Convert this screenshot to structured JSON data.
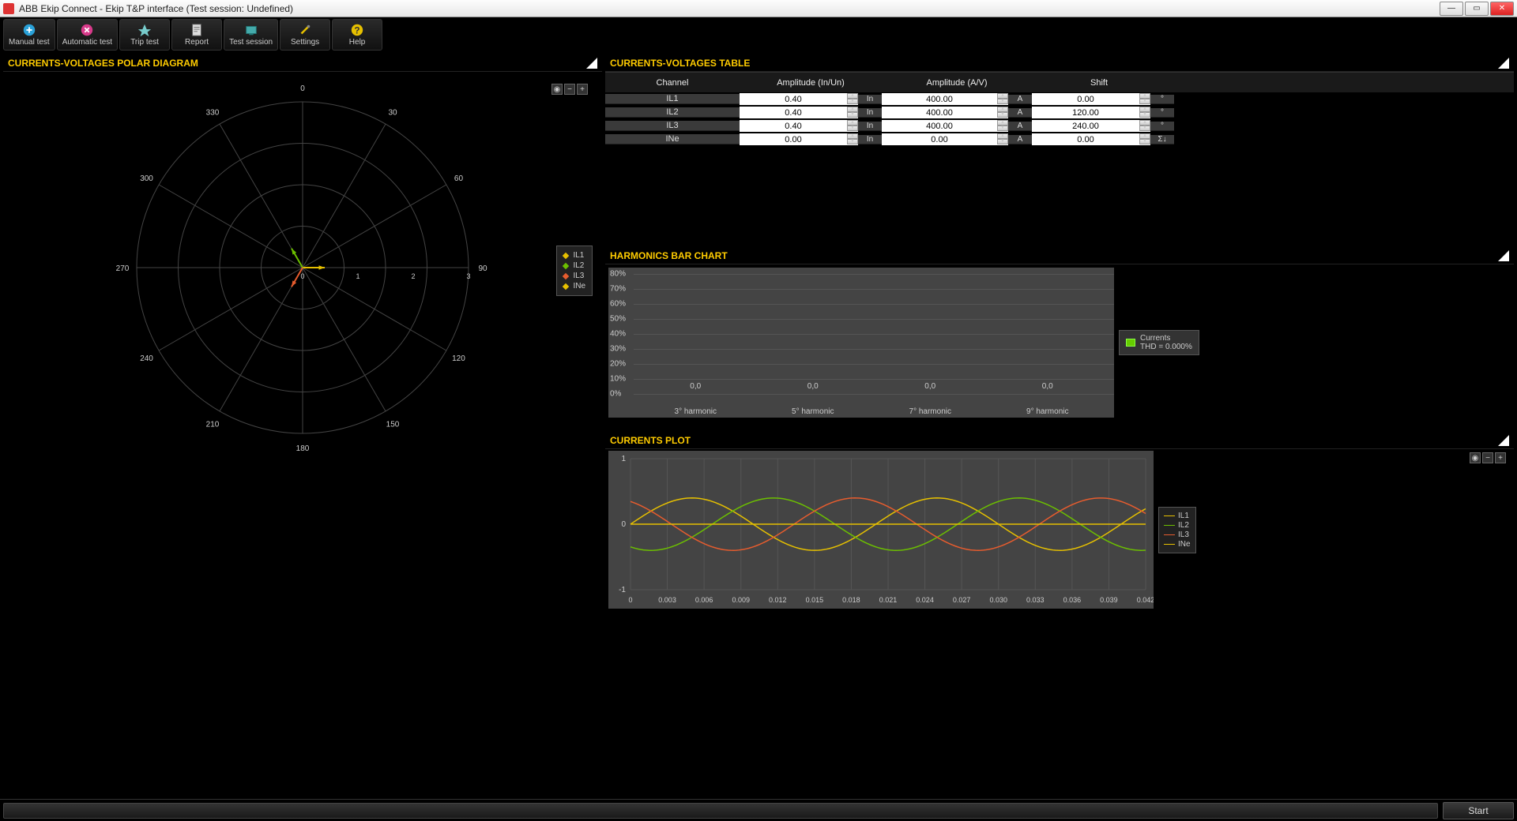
{
  "window": {
    "title": "ABB Ekip Connect - Ekip T&P interface (Test session: Undefined)"
  },
  "toolbar": {
    "manual_test": "Manual test",
    "automatic_test": "Automatic test",
    "trip_test": "Trip test",
    "report": "Report",
    "test_session": "Test session",
    "settings": "Settings",
    "help": "Help"
  },
  "panels": {
    "cv_table": "CURRENTS-VOLTAGES TABLE",
    "harmonics": "HARMONICS BAR CHART",
    "currents_plot": "CURRENTS PLOT",
    "polar": "CURRENTS-VOLTAGES POLAR DIAGRAM"
  },
  "table": {
    "headers": {
      "channel": "Channel",
      "amp_inun": "Amplitude (In/Un)",
      "amp_av": "Amplitude (A/V)",
      "shift": "Shift"
    },
    "rows": [
      {
        "ch": "IL1",
        "amp1": "0.40",
        "u1": "In",
        "amp2": "400.00",
        "u2": "A",
        "shift": "0.00",
        "u3": "°"
      },
      {
        "ch": "IL2",
        "amp1": "0.40",
        "u1": "In",
        "amp2": "400.00",
        "u2": "A",
        "shift": "120.00",
        "u3": "°"
      },
      {
        "ch": "IL3",
        "amp1": "0.40",
        "u1": "In",
        "amp2": "400.00",
        "u2": "A",
        "shift": "240.00",
        "u3": "°"
      },
      {
        "ch": "INe",
        "amp1": "0.00",
        "u1": "In",
        "amp2": "0.00",
        "u2": "A",
        "shift": "0.00",
        "u3": "°"
      }
    ],
    "sigma": "Σ↓"
  },
  "harmonics_legend": {
    "name": "Currents",
    "thd": "THD =  0.000%"
  },
  "polar_legend": [
    {
      "name": "IL1",
      "color": "#e6c000"
    },
    {
      "name": "IL2",
      "color": "#6cbf00"
    },
    {
      "name": "IL3",
      "color": "#e65c2e"
    },
    {
      "name": "INe",
      "color": "#e6c000"
    }
  ],
  "cplot_legend": [
    {
      "name": "IL1",
      "color": "#e6c000"
    },
    {
      "name": "IL2",
      "color": "#6cbf00"
    },
    {
      "name": "IL3",
      "color": "#e65c2e"
    },
    {
      "name": "INe",
      "color": "#e6c000"
    }
  ],
  "footer": {
    "start": "Start"
  },
  "chart_data": [
    {
      "type": "bar",
      "title": "HARMONICS BAR CHART",
      "categories": [
        "3° harmonic",
        "5° harmonic",
        "7° harmonic",
        "9° harmonic"
      ],
      "values": [
        0.0,
        0.0,
        0.0,
        0.0
      ],
      "ylabel": "%",
      "ylim": [
        0,
        80
      ],
      "yticks": [
        0,
        10,
        20,
        30,
        40,
        50,
        60,
        70,
        80
      ],
      "legend": "Currents THD = 0.000%"
    },
    {
      "type": "line",
      "title": "CURRENTS PLOT",
      "x_range": [
        0,
        0.042
      ],
      "xticks": [
        0,
        0.003,
        0.006,
        0.009,
        0.012,
        0.015,
        0.018,
        0.021,
        0.024,
        0.027,
        0.03,
        0.033,
        0.036,
        0.039,
        0.042
      ],
      "ylim": [
        -1,
        1
      ],
      "yticks": [
        -1,
        0,
        1
      ],
      "series": [
        {
          "name": "IL1",
          "amplitude": 0.4,
          "phase_deg": 0,
          "freq_hz": 50,
          "color": "#e6c000"
        },
        {
          "name": "IL2",
          "amplitude": 0.4,
          "phase_deg": 120,
          "freq_hz": 50,
          "color": "#6cbf00"
        },
        {
          "name": "IL3",
          "amplitude": 0.4,
          "phase_deg": 240,
          "freq_hz": 50,
          "color": "#e65c2e"
        },
        {
          "name": "INe",
          "amplitude": 0.0,
          "phase_deg": 0,
          "freq_hz": 50,
          "color": "#e6c000"
        }
      ]
    },
    {
      "type": "polar",
      "title": "CURRENTS-VOLTAGES POLAR DIAGRAM",
      "angle_ticks": [
        0,
        30,
        60,
        90,
        120,
        150,
        180,
        210,
        240,
        270,
        300,
        330
      ],
      "radial_ticks": [
        0,
        1,
        2,
        3
      ],
      "radial_max": 3,
      "vectors": [
        {
          "name": "IL1",
          "magnitude": 0.4,
          "angle_deg": 0,
          "color": "#e6c000"
        },
        {
          "name": "IL2",
          "magnitude": 0.4,
          "angle_deg": 120,
          "color": "#6cbf00"
        },
        {
          "name": "IL3",
          "magnitude": 0.4,
          "angle_deg": 240,
          "color": "#e65c2e"
        },
        {
          "name": "INe",
          "magnitude": 0.0,
          "angle_deg": 0,
          "color": "#e6c000"
        }
      ]
    }
  ]
}
